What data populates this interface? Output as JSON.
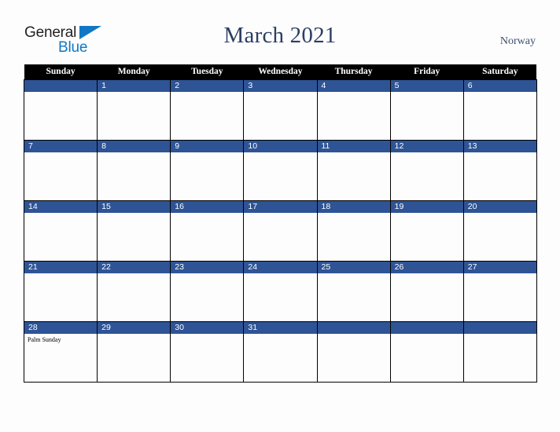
{
  "brand": {
    "word_one": "General",
    "word_two": "Blue",
    "triangle_icon": "triangle-icon",
    "color_dark": "#231f20",
    "color_blue": "#1177c4"
  },
  "header": {
    "title": "March 2021",
    "country": "Norway",
    "title_color": "#2b3f63"
  },
  "calendar": {
    "weekday_headers": [
      "Sunday",
      "Monday",
      "Tuesday",
      "Wednesday",
      "Thursday",
      "Friday",
      "Saturday"
    ],
    "header_bg": "#000000",
    "daynum_bg": "#2e5496",
    "daynum_color": "#ffffff",
    "cell_bg": "#fdfdfd",
    "weeks": [
      [
        {
          "day": "",
          "events": []
        },
        {
          "day": "1",
          "events": []
        },
        {
          "day": "2",
          "events": []
        },
        {
          "day": "3",
          "events": []
        },
        {
          "day": "4",
          "events": []
        },
        {
          "day": "5",
          "events": []
        },
        {
          "day": "6",
          "events": []
        }
      ],
      [
        {
          "day": "7",
          "events": []
        },
        {
          "day": "8",
          "events": []
        },
        {
          "day": "9",
          "events": []
        },
        {
          "day": "10",
          "events": []
        },
        {
          "day": "11",
          "events": []
        },
        {
          "day": "12",
          "events": []
        },
        {
          "day": "13",
          "events": []
        }
      ],
      [
        {
          "day": "14",
          "events": []
        },
        {
          "day": "15",
          "events": []
        },
        {
          "day": "16",
          "events": []
        },
        {
          "day": "17",
          "events": []
        },
        {
          "day": "18",
          "events": []
        },
        {
          "day": "19",
          "events": []
        },
        {
          "day": "20",
          "events": []
        }
      ],
      [
        {
          "day": "21",
          "events": []
        },
        {
          "day": "22",
          "events": []
        },
        {
          "day": "23",
          "events": []
        },
        {
          "day": "24",
          "events": []
        },
        {
          "day": "25",
          "events": []
        },
        {
          "day": "26",
          "events": []
        },
        {
          "day": "27",
          "events": []
        }
      ],
      [
        {
          "day": "28",
          "events": [
            "Palm Sunday"
          ]
        },
        {
          "day": "29",
          "events": []
        },
        {
          "day": "30",
          "events": []
        },
        {
          "day": "31",
          "events": []
        },
        {
          "day": "",
          "events": []
        },
        {
          "day": "",
          "events": []
        },
        {
          "day": "",
          "events": []
        }
      ]
    ]
  }
}
